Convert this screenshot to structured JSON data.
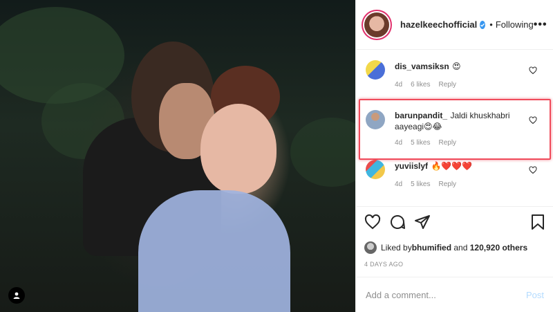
{
  "post": {
    "account": "hazelkeechofficial",
    "separator": "•",
    "follow_status": "Following",
    "more": "•••"
  },
  "comments": [
    {
      "user": "dis_vamsiksn",
      "text": "😍",
      "age": "4d",
      "likes": "6 likes",
      "reply": "Reply"
    },
    {
      "user": "barunpandit_",
      "text": "Jaldi khuskhabri aayeagi😍😂",
      "age": "4d",
      "likes": "5 likes",
      "reply": "Reply",
      "highlighted": true
    },
    {
      "user": "yuviislyf",
      "text": "🔥❤️❤️❤️",
      "age": "4d",
      "likes": "5 likes",
      "reply": "Reply"
    }
  ],
  "likes": {
    "prefix": "Liked by ",
    "user": "bhumified",
    "and": " and ",
    "count": "120,920 others"
  },
  "date": "4 DAYS AGO",
  "add_comment": {
    "placeholder": "Add a comment...",
    "post_label": "Post"
  },
  "colors": {
    "highlight": "#f04a5a",
    "verified": "#3897f0",
    "post_disabled": "#b3dbff"
  },
  "icons": [
    "heart-icon",
    "comment-icon",
    "share-icon",
    "bookmark-icon",
    "verified-icon",
    "more-icon",
    "user-tag-icon"
  ]
}
